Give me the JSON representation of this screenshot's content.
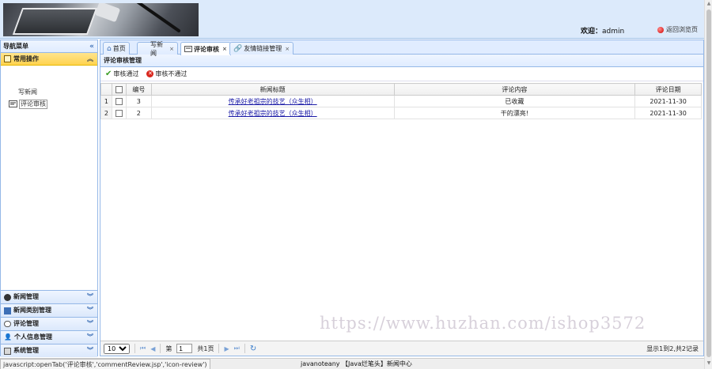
{
  "header": {
    "welcome_label": "欢迎：",
    "user": "admin",
    "back_label": "返回浏览页"
  },
  "sidebar": {
    "title": "导航菜单",
    "open_group": "常用操作",
    "items": [
      {
        "label": "写新闻"
      },
      {
        "label": "评论审核"
      }
    ],
    "groups": [
      {
        "label": "新闻管理"
      },
      {
        "label": "新闻类别管理"
      },
      {
        "label": "评论管理"
      },
      {
        "label": "个人信息管理"
      },
      {
        "label": "系统管理"
      }
    ]
  },
  "tabs": [
    {
      "label": "首页"
    },
    {
      "label": "写新闻"
    },
    {
      "label": "评论审核"
    },
    {
      "label": "友情链接管理"
    }
  ],
  "panel": {
    "title": "评论审核管理",
    "approve_label": "审核通过",
    "reject_label": "审核不通过"
  },
  "table": {
    "columns": [
      "编号",
      "新闻标题",
      "评论内容",
      "评论日期"
    ],
    "rows": [
      {
        "rownum": "1",
        "id": "3",
        "title": "传承好老祖宗的技艺（众生相）",
        "comment": "已收藏",
        "date": "2021-11-30"
      },
      {
        "rownum": "2",
        "id": "2",
        "title": "传承好老祖宗的技艺（众生相）",
        "comment": "干的漂亮!",
        "date": "2021-11-30"
      }
    ]
  },
  "pager": {
    "page_size": "10",
    "page_prefix": "第",
    "page_value": "1",
    "page_suffix": "共1页",
    "info": "显示1到2,共2记录"
  },
  "watermark": "https://www.huzhan.com/ishop3572",
  "statusbar": {
    "url": "javascript:openTab('评论审核','commentReview.jsp','icon-review')",
    "footer": "javanoteany 【Java烂笔头】新闻中心"
  }
}
